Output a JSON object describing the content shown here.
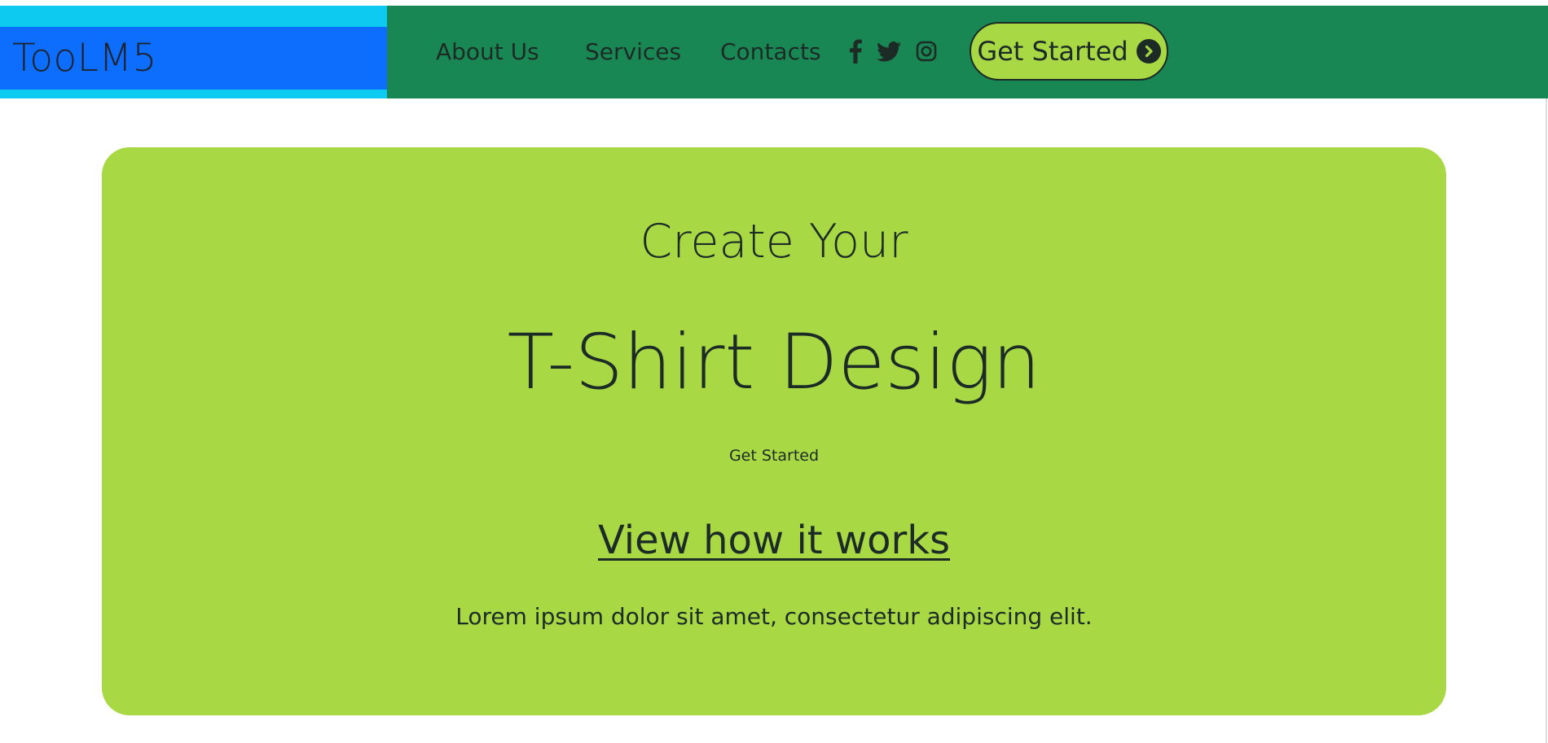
{
  "brand": {
    "name": "TooLM5"
  },
  "nav": {
    "items": [
      {
        "label": "About Us"
      },
      {
        "label": "Services"
      },
      {
        "label": "Contacts"
      }
    ],
    "social": [
      {
        "icon": "facebook-icon"
      },
      {
        "icon": "twitter-icon"
      },
      {
        "icon": "instagram-icon"
      }
    ],
    "cta": {
      "label": "Get Started",
      "icon": "chevron-circle-right-icon"
    }
  },
  "hero": {
    "kicker": "Create Your",
    "title": "T-Shirt Design",
    "small_link": "Get Started",
    "link": "View how it works",
    "text": "Lorem ipsum dolor sit amet, consectetur adipiscing elit."
  },
  "colors": {
    "brand_outer": "#0dcaf0",
    "brand_inner": "#0d6efd",
    "navbar": "#198754",
    "accent": "#a8d844",
    "text": "#1d2b26"
  }
}
